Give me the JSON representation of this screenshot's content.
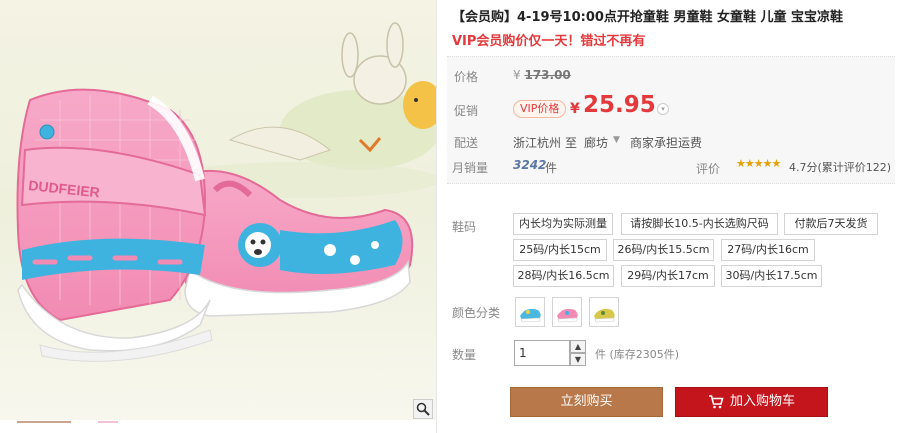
{
  "product": {
    "title": "【会员购】4-19号10:00点开抢童鞋 男童鞋 女童鞋 儿童 宝宝凉鞋",
    "subtitle": "VIP会员购价仅一天！错过不再有",
    "image_logo_text": "DUDFEIER"
  },
  "pricing": {
    "original_label": "价格",
    "original_currency": "¥",
    "original_price": "173.00",
    "promo_label": "促销",
    "vip_badge": "VIP价格",
    "currency": "¥",
    "price": "25.95"
  },
  "shipping": {
    "label": "配送",
    "from": "浙江杭州",
    "to": "至",
    "area": "廊坊",
    "note": "商家承担运费"
  },
  "stats": {
    "sales_label": "月销量",
    "sales_count": "3242",
    "sales_unit": "件",
    "rating_label": "评价",
    "stars": "★★★★★",
    "rating_text": "4.7分(累计评价122)"
  },
  "sku": {
    "size_label": "鞋码",
    "sizes": [
      "内长均为实际测量",
      "请按脚长10.5-内长选购尺码",
      "付款后7天发货",
      "25码/内长15cm",
      "26码/内长15.5cm",
      "27码/内长16cm",
      "28码/内长16.5cm",
      "29码/内长17cm",
      "30码/内长17.5cm"
    ],
    "color_label": "颜色分类",
    "quantity_label": "数量",
    "quantity_value": "1",
    "stock_text": "件 (库存2305件)"
  },
  "actions": {
    "buy_now": "立刻购买",
    "add_to_cart": "加入购物车"
  },
  "colors": {
    "accent_red": "#e4393c",
    "buy_brown": "#b9784a",
    "cart_red": "#c4151c"
  }
}
